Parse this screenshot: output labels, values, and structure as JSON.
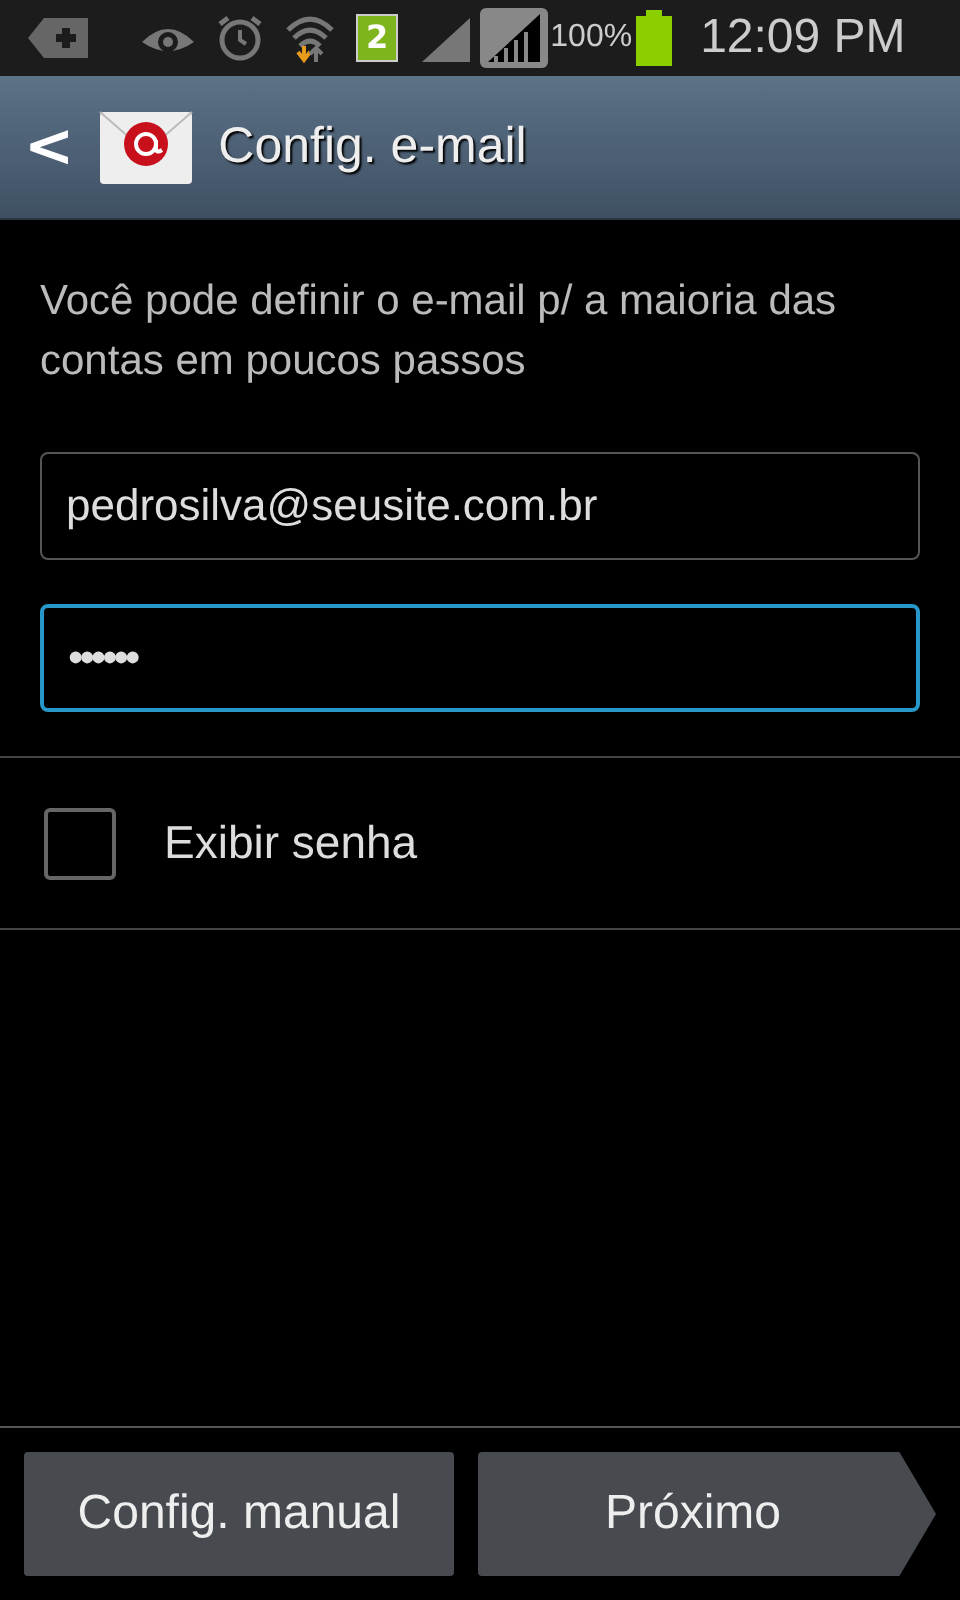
{
  "status_bar": {
    "sim_badge": "2",
    "battery_percent": "100%",
    "time": "12:09 PM"
  },
  "action_bar": {
    "back": "<",
    "title": "Config. e-mail"
  },
  "intro": "Você pode definir o e-mail p/ a maioria das contas em poucos passos",
  "fields": [
    {
      "kind": "email",
      "value": "pedrosilva@seusite.com.br",
      "focused": false
    },
    {
      "kind": "password",
      "value": "••••••",
      "focused": true
    }
  ],
  "show_password": {
    "label": "Exibir senha",
    "checked": false
  },
  "buttons": [
    {
      "kind": "plain",
      "label": "Config. manual"
    },
    {
      "kind": "next",
      "label": "Próximo"
    }
  ]
}
